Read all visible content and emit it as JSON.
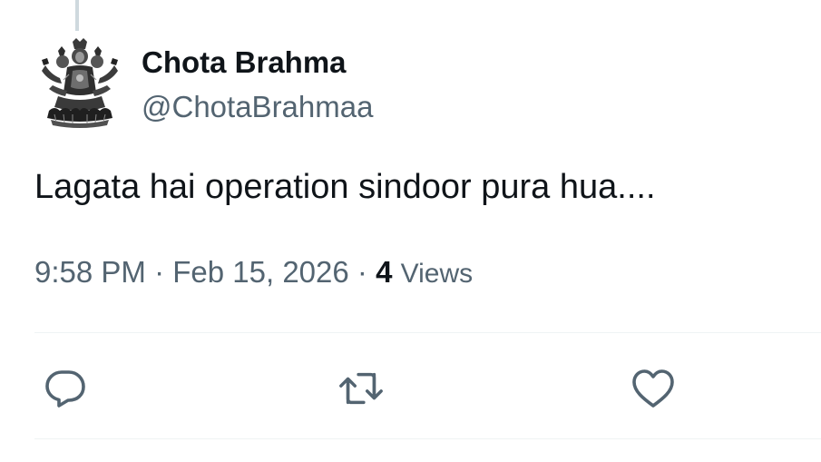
{
  "tweet": {
    "author": {
      "display_name": "Chota Brahma",
      "handle": "@ChotaBrahmaa",
      "avatar_icon": "four-faced-deity-avatar"
    },
    "text": "Lagata hai operation sindoor pura hua....",
    "meta": {
      "time": "9:58 PM",
      "separator": "·",
      "date": "Feb 15, 2026",
      "views_count": "4",
      "views_label": "Views"
    },
    "actions": [
      {
        "icon": "reply-icon"
      },
      {
        "icon": "retweet-icon"
      },
      {
        "icon": "like-heart-icon"
      }
    ]
  },
  "colors": {
    "primary_text": "#0f1419",
    "secondary_text": "#536471",
    "divider": "#eff3f4",
    "thread_line": "#cfd9de"
  }
}
